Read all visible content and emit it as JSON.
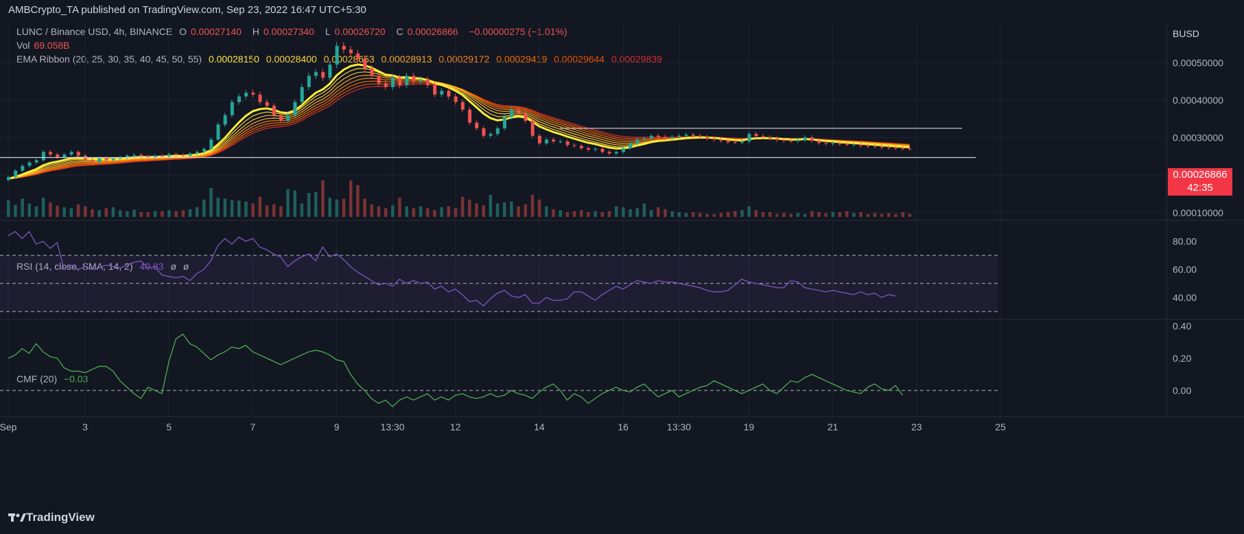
{
  "header": {
    "published": "AMBCrypto_TA published on TradingView.com, Sep 23, 2022 16:47 UTC+5:30"
  },
  "currency_label": "BUSD",
  "legend": {
    "symbol": "LUNC / Binance USD, 4h, BINANCE",
    "o_label": "O",
    "o": "0.00027140",
    "h_label": "H",
    "h": "0.00027340",
    "l_label": "L",
    "l": "0.00026720",
    "c_label": "C",
    "c": "0.00026866",
    "change": "−0.00000275 (−1.01%)",
    "vol_label": "Vol",
    "vol": "69.058B",
    "ema_label": "EMA Ribbon (20, 25, 30, 35, 40, 45, 50, 55)",
    "ema_values": [
      "0.00028150",
      "0.00028400",
      "0.00028653",
      "0.00028913",
      "0.00029172",
      "0.00029419",
      "0.00029644",
      "0.00029839"
    ],
    "rsi_label": "RSI (14, close, SMA, 14, 2)",
    "rsi_value": "40.83",
    "rsi_na1": "ø",
    "rsi_na2": "ø",
    "cmf_label": "CMF (20)",
    "cmf_value": "−0.03"
  },
  "price_tag": {
    "price": "0.00026866",
    "countdown": "42:35"
  },
  "colors": {
    "up": "#26a69a",
    "down": "#ef5350",
    "rsi": "#7e57c2",
    "cmf": "#4caf50",
    "ema": [
      "#ffeb3b",
      "#fdd835",
      "#fbc02d",
      "#f9a825",
      "#f57f17",
      "#ef6c00",
      "#e65100",
      "#d32f2f"
    ]
  },
  "footer": {
    "brand": "TradingView"
  },
  "chart_data": [
    {
      "type": "candlestick",
      "title": "LUNC / Binance USD",
      "ylim": [
        8.5e-05,
        0.000605
      ],
      "ytick_values": [
        0.0001,
        0.0002,
        0.0003,
        0.0004,
        0.0005
      ],
      "ytick_labels": [
        "0.00010000",
        "0.00020000",
        "0.00030000",
        "0.00040000",
        "0.00050000"
      ],
      "x_labels": [
        {
          "t": 0,
          "label": "Sep"
        },
        {
          "t": 11,
          "label": "3"
        },
        {
          "t": 23,
          "label": "5"
        },
        {
          "t": 35,
          "label": "7"
        },
        {
          "t": 47,
          "label": "9"
        },
        {
          "t": 55,
          "label": "13:30"
        },
        {
          "t": 64,
          "label": "12"
        },
        {
          "t": 76,
          "label": "14"
        },
        {
          "t": 88,
          "label": "16"
        },
        {
          "t": 96,
          "label": "13:30"
        },
        {
          "t": 106,
          "label": "19"
        },
        {
          "t": 118,
          "label": "21"
        },
        {
          "t": 130,
          "label": "23"
        },
        {
          "t": 142,
          "label": "25"
        }
      ],
      "close": [
        0.000195,
        0.000212,
        0.000225,
        0.000234,
        0.00024,
        0.000262,
        0.000255,
        0.000248,
        0.000255,
        0.000262,
        0.000252,
        0.000241,
        0.000235,
        0.000245,
        0.00024,
        0.000244,
        0.000247,
        0.000252,
        0.000254,
        0.00025,
        0.000248,
        0.000252,
        0.00025,
        0.000256,
        0.000254,
        0.000252,
        0.000258,
        0.000262,
        0.00027,
        0.000295,
        0.000335,
        0.00036,
        0.000395,
        0.00041,
        0.00042,
        0.000415,
        0.000395,
        0.000385,
        0.00036,
        0.000345,
        0.00036,
        0.000395,
        0.000435,
        0.000465,
        0.000475,
        0.00046,
        0.000495,
        0.000545,
        0.000535,
        0.000525,
        0.00051,
        0.000485,
        0.000465,
        0.000445,
        0.000435,
        0.00046,
        0.00044,
        0.000465,
        0.00045,
        0.000455,
        0.00044,
        0.000415,
        0.000425,
        0.00041,
        0.000395,
        0.000375,
        0.00034,
        0.000325,
        0.000305,
        0.00031,
        0.000325,
        0.000355,
        0.000375,
        0.000365,
        0.000345,
        0.000305,
        0.000285,
        0.000295,
        0.00029,
        0.00029,
        0.00028,
        0.000278,
        0.000272,
        0.000268,
        0.00027,
        0.000262,
        0.000258,
        0.000262,
        0.000272,
        0.000285,
        0.000295,
        0.000298,
        0.000305,
        0.000302,
        0.000298,
        0.000302,
        0.000305,
        0.000308,
        0.000305,
        0.000302,
        0.000298,
        0.000295,
        0.000292,
        0.000288,
        0.000287,
        0.00029,
        0.00031,
        0.000304,
        0.000301,
        0.000298,
        0.000294,
        0.000292,
        0.000291,
        0.000294,
        0.000301,
        0.000292,
        0.000286,
        0.000284,
        0.000285,
        0.000283,
        0.000281,
        0.000282,
        0.000279,
        0.000278,
        0.000277,
        0.000274,
        0.000273,
        0.000272,
        0.000271,
        0.00027
      ],
      "volume_index": [
        0.35,
        0.25,
        0.38,
        0.28,
        0.22,
        0.4,
        0.3,
        0.24,
        0.2,
        0.18,
        0.26,
        0.22,
        0.16,
        0.14,
        0.18,
        0.2,
        0.14,
        0.12,
        0.15,
        0.1,
        0.1,
        0.12,
        0.12,
        0.14,
        0.12,
        0.14,
        0.16,
        0.2,
        0.36,
        0.6,
        0.4,
        0.38,
        0.35,
        0.34,
        0.32,
        0.28,
        0.42,
        0.24,
        0.26,
        0.22,
        0.58,
        0.55,
        0.28,
        0.5,
        0.52,
        0.76,
        0.4,
        0.36,
        0.38,
        0.76,
        0.66,
        0.38,
        0.26,
        0.22,
        0.18,
        0.24,
        0.4,
        0.22,
        0.18,
        0.22,
        0.18,
        0.14,
        0.2,
        0.22,
        0.18,
        0.42,
        0.36,
        0.28,
        0.24,
        0.46,
        0.28,
        0.3,
        0.32,
        0.22,
        0.26,
        0.46,
        0.36,
        0.22,
        0.16,
        0.14,
        0.1,
        0.12,
        0.14,
        0.1,
        0.12,
        0.1,
        0.12,
        0.22,
        0.2,
        0.16,
        0.18,
        0.28,
        0.14,
        0.2,
        0.16,
        0.12,
        0.1,
        0.08,
        0.1,
        0.08,
        0.06,
        0.06,
        0.08,
        0.1,
        0.12,
        0.14,
        0.22,
        0.14,
        0.1,
        0.1,
        0.06,
        0.08,
        0.06,
        0.08,
        0.06,
        0.12,
        0.1,
        0.08,
        0.1,
        0.1,
        0.12,
        0.08,
        0.1,
        0.06,
        0.08,
        0.06,
        0.08,
        0.06,
        0.1,
        0.06
      ],
      "hlines": [
        0.000325,
        0.000247
      ]
    },
    {
      "type": "line",
      "title": "RSI (14, close, SMA, 14, 2)",
      "ylim": [
        26,
        93
      ],
      "ytick_values": [
        40,
        60,
        80
      ],
      "ytick_labels": [
        "40.00",
        "60.00",
        "80.00"
      ],
      "band": [
        30,
        70
      ],
      "midline": 50,
      "values": [
        84,
        87,
        82,
        87,
        78,
        80,
        75,
        79,
        60,
        63,
        60,
        62,
        60,
        61,
        63,
        62,
        61,
        63,
        65,
        66,
        61,
        62,
        56,
        55,
        54,
        55,
        52,
        57,
        60,
        66,
        77,
        82,
        78,
        83,
        80,
        82,
        76,
        74,
        71,
        69,
        62,
        66,
        69,
        71,
        66,
        76,
        69,
        71,
        67,
        62,
        58,
        55,
        52,
        49,
        50,
        48,
        53,
        50,
        52,
        50,
        51,
        46,
        48,
        44,
        46,
        42,
        37,
        38,
        34,
        39,
        43,
        45,
        41,
        40,
        42,
        36,
        36,
        40,
        38,
        38,
        39,
        44,
        44,
        41,
        38,
        42,
        45,
        48,
        46,
        49,
        52,
        51,
        50,
        52,
        51,
        51,
        50,
        49,
        48,
        47,
        45,
        44,
        44,
        45,
        49,
        53,
        51,
        50,
        49,
        48,
        47,
        47,
        52,
        51,
        47,
        46,
        45,
        44,
        45,
        44,
        43,
        42,
        44,
        42,
        43,
        40,
        42,
        41
      ]
    },
    {
      "type": "line",
      "title": "CMF (20)",
      "ylim": [
        -0.15,
        0.43
      ],
      "ytick_values": [
        0.0,
        0.2,
        0.4
      ],
      "ytick_labels": [
        "0.00",
        "0.20",
        "0.40"
      ],
      "midline": 0,
      "values": [
        0.2,
        0.22,
        0.26,
        0.23,
        0.29,
        0.24,
        0.21,
        0.2,
        0.14,
        0.12,
        0.12,
        0.11,
        0.13,
        0.15,
        0.15,
        0.12,
        0.06,
        0.02,
        -0.02,
        -0.05,
        0.02,
        0.0,
        -0.02,
        0.18,
        0.32,
        0.35,
        0.29,
        0.27,
        0.23,
        0.19,
        0.22,
        0.24,
        0.27,
        0.26,
        0.28,
        0.24,
        0.22,
        0.2,
        0.18,
        0.16,
        0.18,
        0.2,
        0.22,
        0.24,
        0.25,
        0.24,
        0.22,
        0.19,
        0.18,
        0.1,
        0.04,
        0.0,
        -0.05,
        -0.08,
        -0.06,
        -0.1,
        -0.06,
        -0.04,
        -0.06,
        -0.04,
        -0.02,
        -0.06,
        -0.04,
        -0.06,
        -0.03,
        -0.02,
        -0.04,
        -0.05,
        -0.04,
        -0.02,
        -0.04,
        -0.03,
        0.0,
        -0.02,
        -0.03,
        -0.05,
        -0.01,
        0.02,
        0.04,
        0.0,
        -0.06,
        -0.02,
        -0.04,
        -0.08,
        -0.05,
        -0.02,
        0.0,
        0.02,
        0.0,
        -0.01,
        0.02,
        0.04,
        0.0,
        -0.04,
        -0.02,
        0.0,
        -0.04,
        -0.02,
        0.0,
        0.02,
        0.03,
        0.06,
        0.04,
        0.02,
        0.0,
        -0.02,
        0.0,
        0.02,
        0.04,
        0.0,
        -0.02,
        0.02,
        0.06,
        0.05,
        0.08,
        0.1,
        0.08,
        0.06,
        0.04,
        0.02,
        0.0,
        -0.01,
        -0.02,
        0.02,
        0.04,
        0.01,
        0.0,
        0.03,
        -0.03
      ]
    }
  ]
}
